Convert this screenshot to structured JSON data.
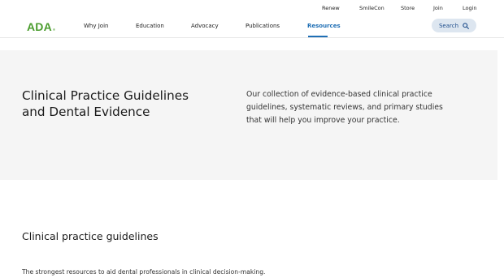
{
  "utility_nav": {
    "items": [
      {
        "label": "Renew"
      },
      {
        "label": "SmileCon"
      },
      {
        "label": "Store"
      },
      {
        "label": "Join"
      },
      {
        "label": "Login"
      }
    ]
  },
  "header": {
    "logo_text": "ADA",
    "logo_mark": "®",
    "nav": [
      {
        "label": "Why Join"
      },
      {
        "label": "Education"
      },
      {
        "label": "Advocacy"
      },
      {
        "label": "Publications"
      },
      {
        "label": "Resources",
        "active": true
      }
    ],
    "search_label": "Search"
  },
  "hero": {
    "title": "Clinical Practice Guidelines and Dental Evidence",
    "description": "Our collection of evidence-based clinical practice guidelines, systematic reviews, and primary studies that will help you improve your practice."
  },
  "section": {
    "title": "Clinical practice guidelines",
    "description": "The strongest resources to aid dental professionals in clinical decision-making."
  },
  "colors": {
    "brand_green": "#4a9c2d",
    "link_blue": "#1f6fb5",
    "hero_bg": "#f5f5f5",
    "search_bg": "#dde6f0"
  },
  "icons": {
    "search": "search-icon"
  }
}
